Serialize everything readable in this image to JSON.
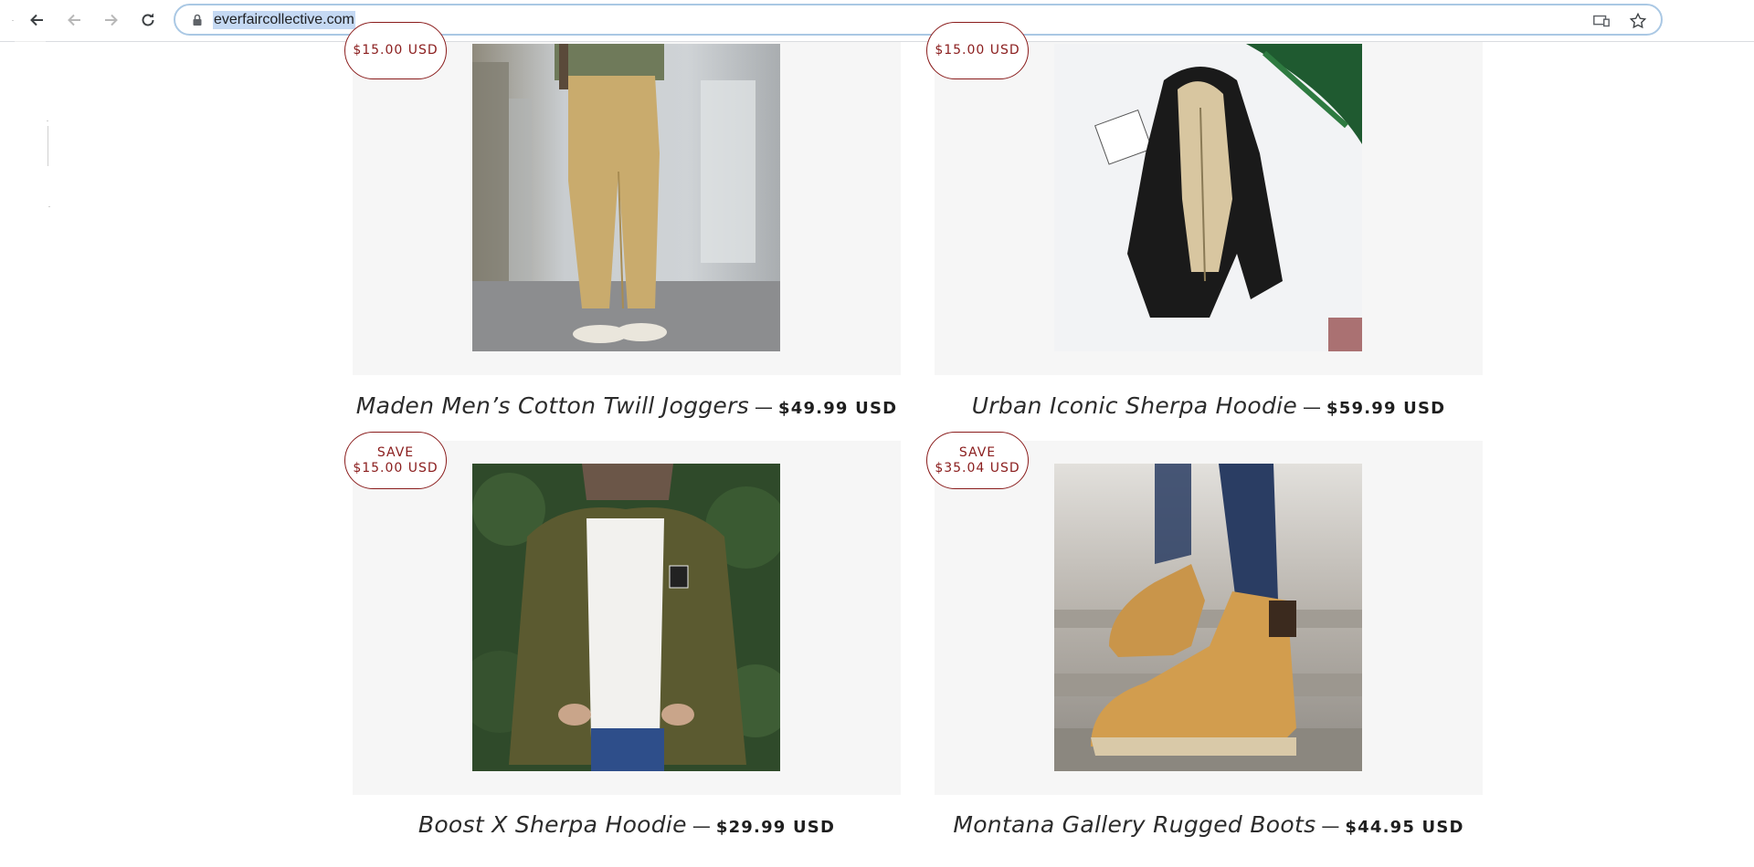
{
  "browser": {
    "url": "everfaircollective.com",
    "back_icon": "arrow-left-icon",
    "forward_icon": "arrow-right-icon",
    "reload_icon": "reload-icon",
    "lock_icon": "lock-icon",
    "cast_icon": "cast-icon",
    "bookmark_icon": "star-icon"
  },
  "products": [
    {
      "badge_line1": "",
      "badge_line2": "$15.00 USD",
      "title": "Maden Men’s Cotton Twill Joggers",
      "separator": "—",
      "price": "$49.99 USD",
      "image": "khaki-joggers-photo"
    },
    {
      "badge_line1": "",
      "badge_line2": "$15.00 USD",
      "title": "Urban Iconic Sherpa Hoodie",
      "separator": "—",
      "price": "$59.99 USD",
      "image": "black-sherpa-hoodie-photo"
    },
    {
      "badge_line1": "SAVE",
      "badge_line2": "$15.00 USD",
      "title": "Boost X Sherpa Hoodie",
      "separator": "—",
      "price": "$29.99 USD",
      "image": "olive-sherpa-jacket-photo"
    },
    {
      "badge_line1": "SAVE",
      "badge_line2": "$35.04 USD",
      "title": "Montana Gallery Rugged Boots",
      "separator": "—",
      "price": "$44.95 USD",
      "image": "tan-boots-photo"
    }
  ],
  "colors": {
    "badge": "#8a1c1c",
    "card_bg": "#f6f6f6",
    "url_highlight": "#c5d9f3"
  }
}
